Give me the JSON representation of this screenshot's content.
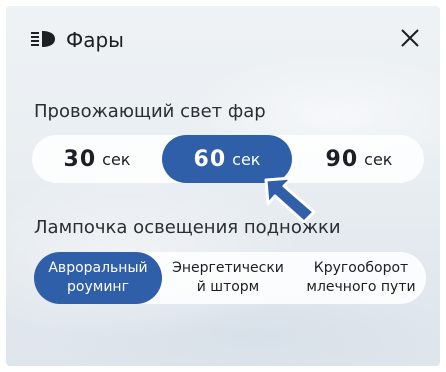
{
  "header": {
    "icon": "headlight-icon",
    "title": "Фары",
    "close_icon": "close-icon"
  },
  "follow_me_home": {
    "label": "Провожающий свет фар",
    "options": [
      {
        "value": "30",
        "unit": "сек",
        "selected": false
      },
      {
        "value": "60",
        "unit": "сек",
        "selected": true
      },
      {
        "value": "90",
        "unit": "сек",
        "selected": false
      }
    ]
  },
  "footwell_light": {
    "label": "Лампочка освещения подножки",
    "options": [
      {
        "label": "Авроральный\nроуминг",
        "selected": true
      },
      {
        "label": "Энергетически\nй шторм",
        "selected": false
      },
      {
        "label": "Кругооборот\nмлечного пути",
        "selected": false
      }
    ]
  },
  "colors": {
    "accent": "#2f5fa9",
    "text": "#1c1f24"
  }
}
